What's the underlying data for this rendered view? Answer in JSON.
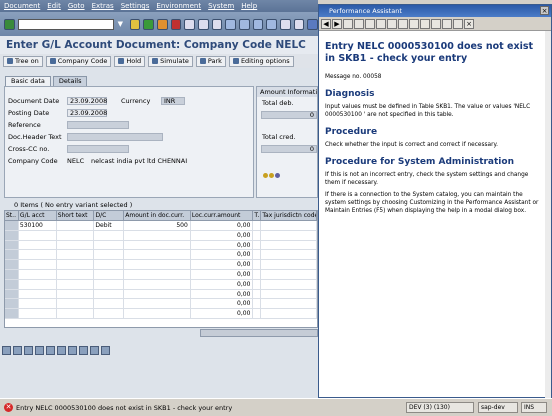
{
  "menu": [
    "Document",
    "Edit",
    "Goto",
    "Extras",
    "Settings",
    "Environment",
    "System",
    "Help"
  ],
  "title": "Enter G/L Account Document: Company Code NELC",
  "toolbar": {
    "tree_on": "Tree on",
    "company_code": "Company Code",
    "hold": "Hold",
    "simulate": "Simulate",
    "park": "Park",
    "editing_options": "Editing options"
  },
  "tabs": [
    "Basic data",
    "Details"
  ],
  "basic": {
    "document_date_label": "Document Date",
    "document_date": "23.09.2008",
    "currency_label": "Currency",
    "currency": "INR",
    "posting_date_label": "Posting Date",
    "posting_date": "23.09.2008",
    "reference_label": "Reference",
    "doc_header_label": "Doc.Header Text",
    "cross_cc_label": "Cross-CC no.",
    "company_code_label": "Company Code",
    "company_code": "NELC",
    "company_name": "nelcast india pvt ltd CHENNAI"
  },
  "amount_info": {
    "header": "Amount Information",
    "total_deb": "Total deb.",
    "total_cred": "Total cred.",
    "deb_value": "0",
    "cred_value": "0"
  },
  "items": {
    "header": "0 Items ( No entry variant selected )",
    "columns": [
      "St..",
      "G/L acct",
      "Short text",
      "D/C",
      "Amount in doc.curr.",
      "Loc.curr.amount",
      "T.",
      "Tax jurisdictn code"
    ],
    "rows": [
      {
        "gl": "530100",
        "dc": "Debit",
        "amt": "500",
        "loc": "0,00"
      },
      {
        "gl": "",
        "dc": "",
        "amt": "",
        "loc": "0,00"
      },
      {
        "gl": "",
        "dc": "",
        "amt": "",
        "loc": "0,00"
      },
      {
        "gl": "",
        "dc": "",
        "amt": "",
        "loc": "0,00"
      },
      {
        "gl": "",
        "dc": "",
        "amt": "",
        "loc": "0,00"
      },
      {
        "gl": "",
        "dc": "",
        "amt": "",
        "loc": "0,00"
      },
      {
        "gl": "",
        "dc": "",
        "amt": "",
        "loc": "0,00"
      },
      {
        "gl": "",
        "dc": "",
        "amt": "",
        "loc": "0,00"
      },
      {
        "gl": "",
        "dc": "",
        "amt": "",
        "loc": "0,00"
      },
      {
        "gl": "",
        "dc": "",
        "amt": "",
        "loc": "0,00"
      }
    ]
  },
  "status": {
    "message": "Entry NELC 0000530100 does not exist in SKB1 - check your entry",
    "system": "DEV (3) (130)",
    "server": "sap-dev",
    "mode": "INS"
  },
  "assistant": {
    "title": "Performance Assistant",
    "heading": "Entry NELC 0000530100  does not exist in SKB1 - check your entry",
    "message_no": "Message no. 00058",
    "diagnosis_h": "Diagnosis",
    "diagnosis": "Input values must be defined in Table SKB1. The value or values 'NELC 0000530100 ' are not specified in this table.",
    "procedure_h": "Procedure",
    "procedure": "Check whether the input is correct and correct if necessary.",
    "sysadmin_h": "Procedure for System Administration",
    "sysadmin1": "If this is not an incorrect entry, check the system settings and change them if necessary.",
    "sysadmin2": "If there is a connection to the System catalog, you can maintain the system settings by choosing Customizing in the Performance Assistant or Maintain Entries (F5) when displaying the help in a modal dialog box."
  }
}
